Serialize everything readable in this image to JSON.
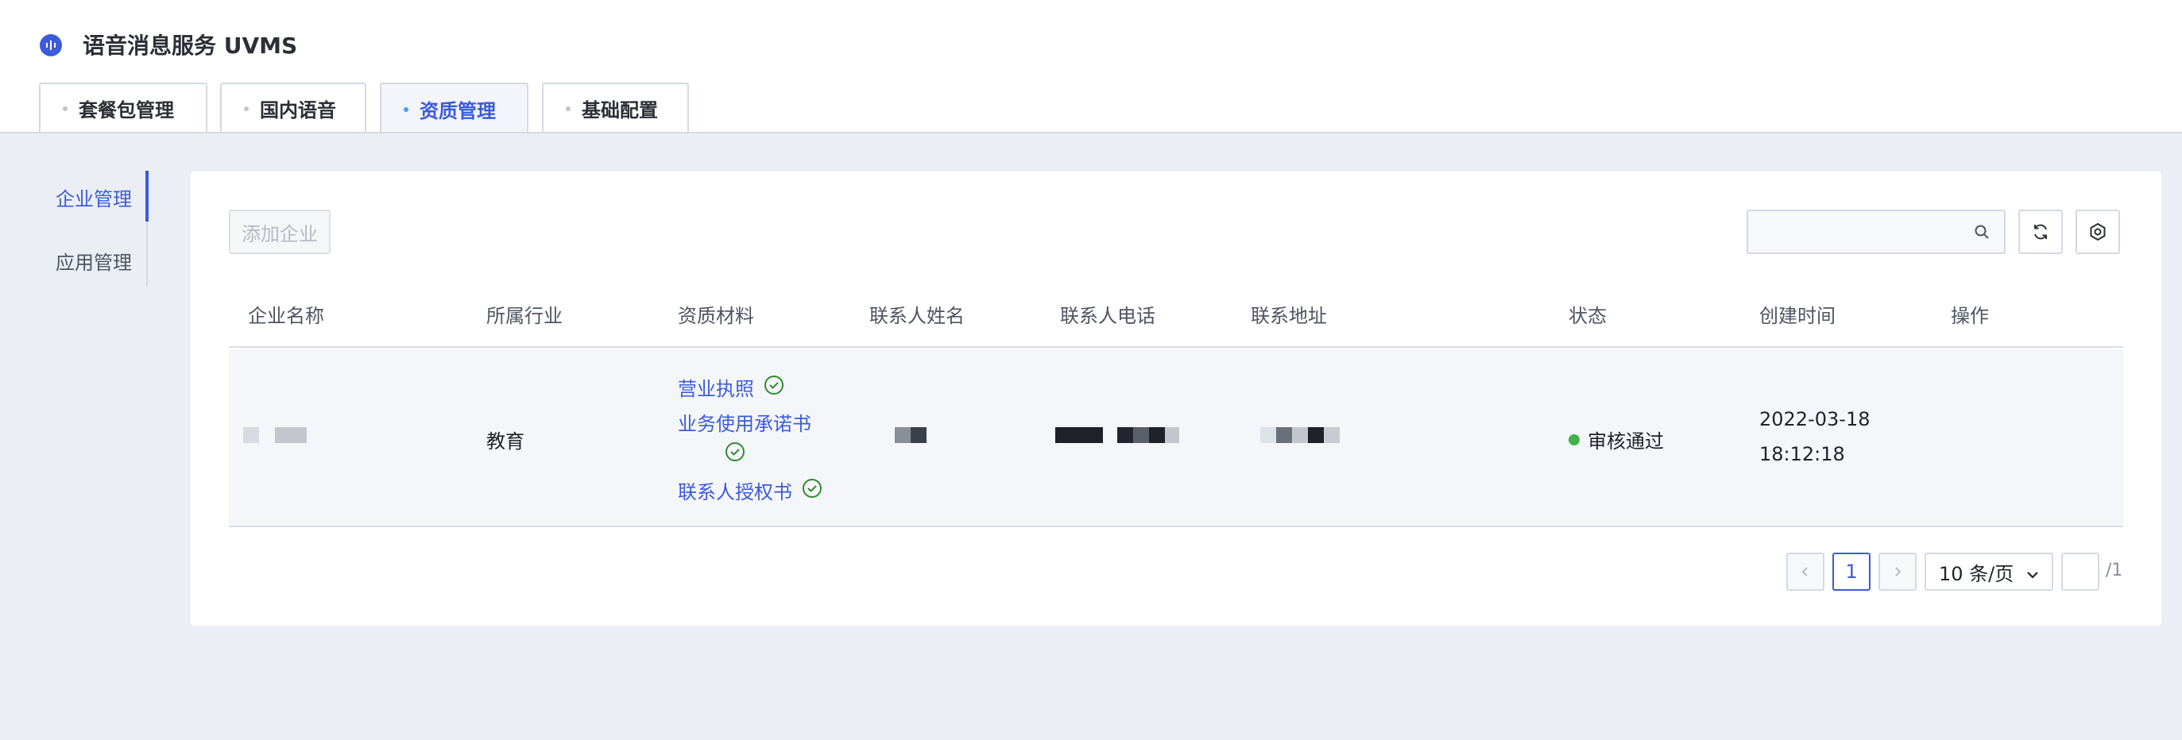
{
  "app": {
    "title": "语音消息服务 UVMS"
  },
  "tabs": [
    {
      "label": "套餐包管理",
      "active": false
    },
    {
      "label": "国内语音",
      "active": false
    },
    {
      "label": "资质管理",
      "active": true
    },
    {
      "label": "基础配置",
      "active": false
    }
  ],
  "sidebar": {
    "items": [
      {
        "label": "企业管理",
        "active": true
      },
      {
        "label": "应用管理",
        "active": false
      }
    ]
  },
  "toolbar": {
    "add_label": "添加企业",
    "search_placeholder": ""
  },
  "table": {
    "columns": [
      "企业名称",
      "所属行业",
      "资质材料",
      "联系人姓名",
      "联系人电话",
      "联系地址",
      "状态",
      "创建时间",
      "操作"
    ],
    "rows": [
      {
        "industry": "教育",
        "materials": [
          "营业执照",
          "业务使用承诺书",
          "联系人授权书"
        ],
        "status": "审核通过",
        "created_date": "2022-03-18",
        "created_time": "18:12:18"
      }
    ]
  },
  "pagination": {
    "current_page": "1",
    "page_size_label": "10 条/页",
    "total_pages": "/1"
  },
  "colors": {
    "accent": "#3b5bdb",
    "success": "#3fb24a",
    "page_bg": "#eceef5"
  }
}
